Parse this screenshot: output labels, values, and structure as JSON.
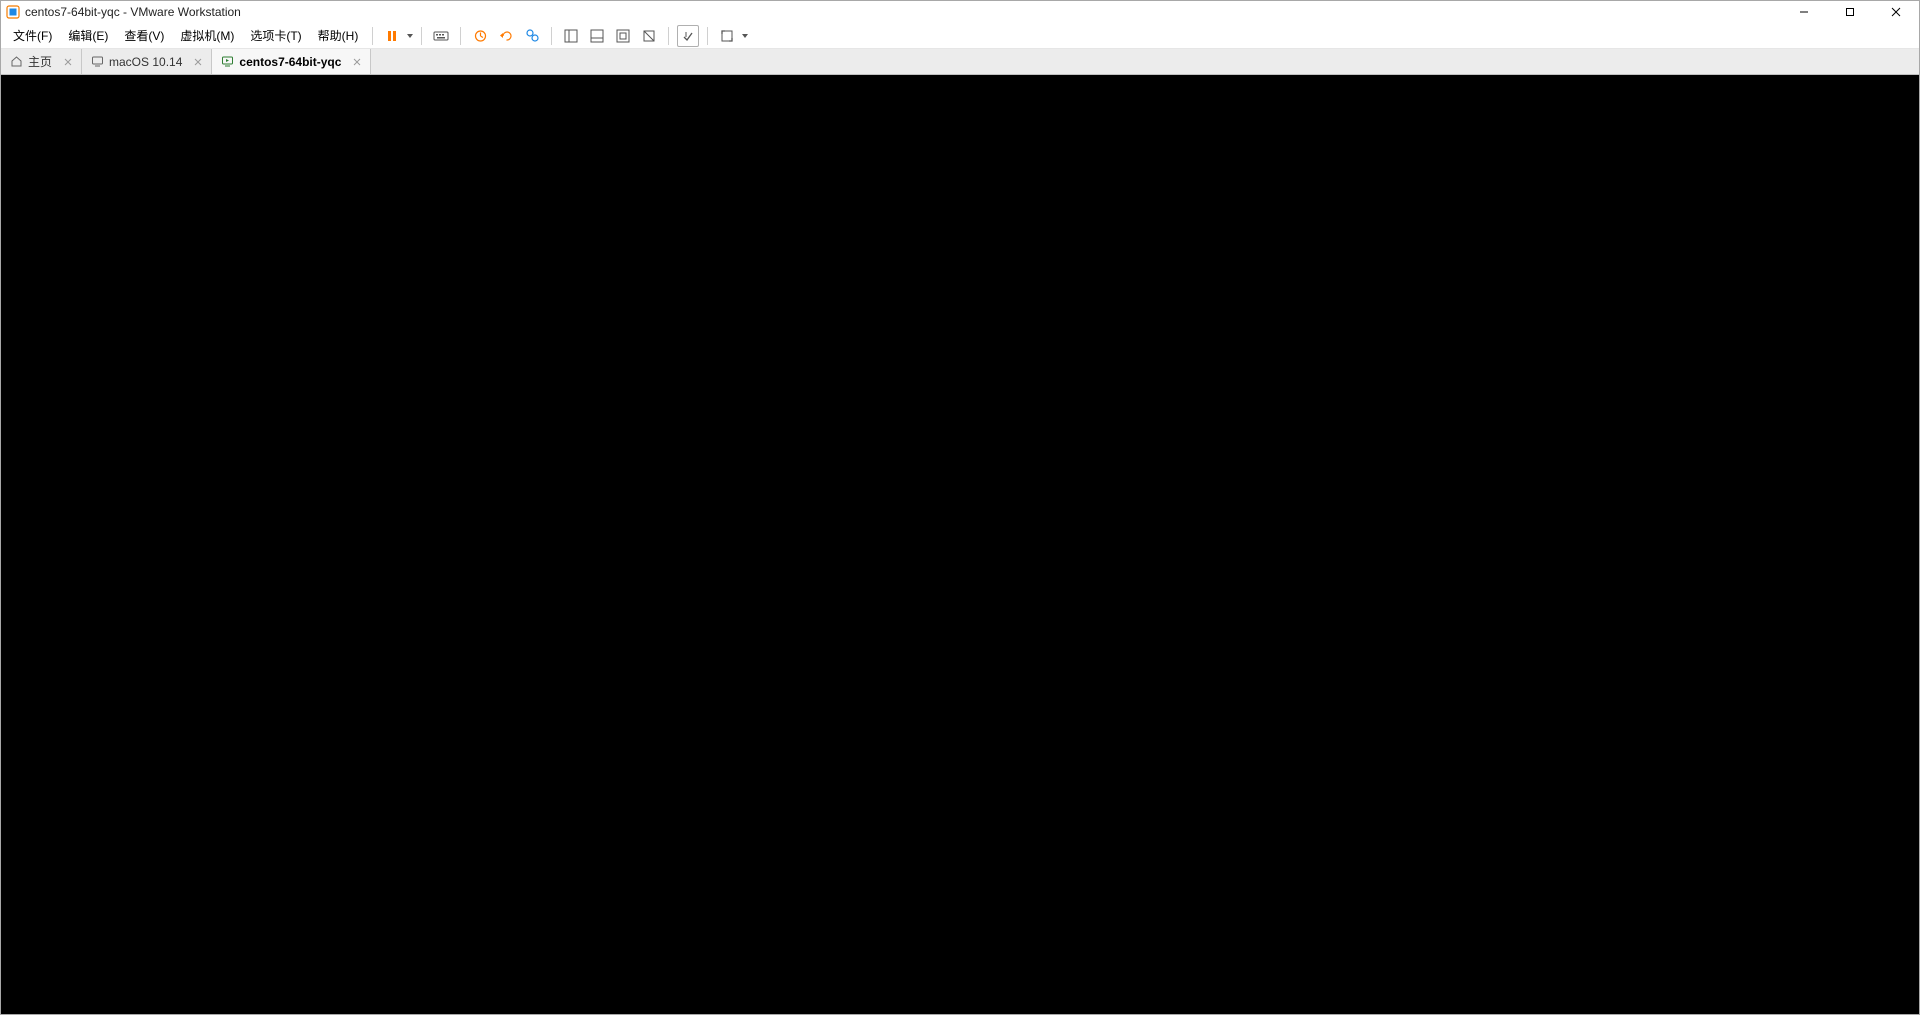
{
  "window": {
    "title": "centos7-64bit-yqc - VMware Workstation"
  },
  "menu": {
    "file": "文件(F)",
    "edit": "编辑(E)",
    "view": "查看(V)",
    "vm": "虚拟机(M)",
    "tabs": "选项卡(T)",
    "help": "帮助(H)"
  },
  "tabs": [
    {
      "label": "主页",
      "active": false,
      "icon": "home"
    },
    {
      "label": "macOS 10.14",
      "active": false,
      "icon": "vm"
    },
    {
      "label": "centos7-64bit-yqc",
      "active": true,
      "icon": "vm-on"
    }
  ]
}
